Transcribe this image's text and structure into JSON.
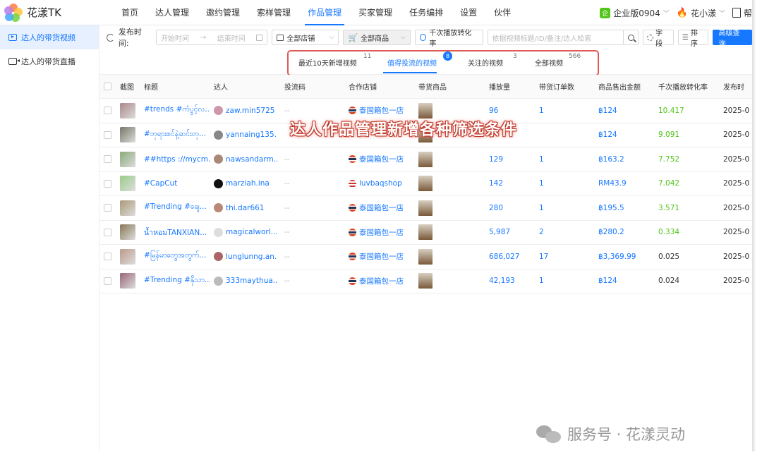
{
  "app": {
    "logo_text": "花漾TK",
    "nav": [
      "首页",
      "达人管理",
      "邀约管理",
      "索样管理",
      "作品管理",
      "买家管理",
      "任务编排",
      "设置",
      "伙伴"
    ],
    "active_nav": "作品管理",
    "enterprise_icon_text": "企",
    "enterprise": "企业版0904",
    "user": "花小漾",
    "right_cut": "帮"
  },
  "sidebar": {
    "items": [
      {
        "label": "达人的带货视频",
        "active": true,
        "icon": "video-icon"
      },
      {
        "label": "达人的带货直播",
        "active": false,
        "icon": "live-icon"
      }
    ]
  },
  "filters": {
    "publish_time_label": "发布时间:",
    "start_placeholder": "开始时间",
    "end_placeholder": "结束时间",
    "date_arrow": "→",
    "shop_select": "全部店铺",
    "product_select": "全部商品",
    "conversion_button": "千次播放转化率",
    "search_placeholder": "依据视频标题/ID/备注/达人检索",
    "fields_button": "字段",
    "sort_button": "排序",
    "advanced_button": "高级查询"
  },
  "tabs": [
    {
      "label": "最近10天新增视频",
      "count": "11",
      "active": false
    },
    {
      "label": "值得投流的视频",
      "count": "8",
      "active": true
    },
    {
      "label": "关注的视频",
      "count": "3",
      "active": false
    },
    {
      "label": "全部视频",
      "count": "566",
      "active": false
    }
  ],
  "table": {
    "columns": [
      "截图",
      "标题",
      "达人",
      "投流码",
      "合作店铺",
      "带货商品",
      "播放量",
      "带货订单数",
      "商品售出金额",
      "千次播放转化率",
      "发布时"
    ],
    "rows": [
      {
        "title": "#trends #ကံပွင့်လ...",
        "creator": "zaw.min5725",
        "code": "--",
        "shop": "泰国箱包一店",
        "shop_flag": "th",
        "plays": "96",
        "orders": "1",
        "amount": "฿124",
        "conv": "10.417",
        "conv_green": true,
        "date": "2025-0"
      },
      {
        "title": "#ဘုရားစင်နဲ့ဆင်းတု...",
        "creator": "yannaing135...",
        "code": "",
        "shop": "",
        "shop_flag": "",
        "plays": "",
        "orders": "",
        "amount": "฿124",
        "conv": "9.091",
        "conv_green": true,
        "date": "2025-0"
      },
      {
        "title": "##https ://mycm...",
        "creator": "nawsandarm...",
        "code": "--",
        "shop": "泰国箱包一店",
        "shop_flag": "th",
        "plays": "129",
        "orders": "1",
        "amount": "฿163.2",
        "conv": "7.752",
        "conv_green": true,
        "date": "2025-0"
      },
      {
        "title": "#CapCut",
        "creator": "marziah.ina",
        "code": "--",
        "shop": "luvbaqshop",
        "shop_flag": "us",
        "plays": "142",
        "orders": "1",
        "amount": "RM43.9",
        "conv": "7.042",
        "conv_green": true,
        "date": "2025-0"
      },
      {
        "title": "#Trending #ချေ...",
        "creator": "thi.dar661",
        "code": "--",
        "shop": "泰国箱包一店",
        "shop_flag": "th",
        "plays": "280",
        "orders": "1",
        "amount": "฿195.5",
        "conv": "3.571",
        "conv_green": true,
        "date": "2025-0"
      },
      {
        "title": "น้ำหอมTANXIAN...",
        "creator": "magicalworl...",
        "code": "--",
        "shop": "泰国箱包一店",
        "shop_flag": "th",
        "plays": "5,987",
        "orders": "2",
        "amount": "฿280.2",
        "conv": "0.334",
        "conv_green": true,
        "date": "2025-0"
      },
      {
        "title": "#မြန်မာတွေအတွက်...",
        "creator": "lunglunng.an...",
        "code": "--",
        "shop": "泰国箱包一店",
        "shop_flag": "th",
        "plays": "686,027",
        "orders": "17",
        "amount": "฿3,369.99",
        "conv": "0.025",
        "conv_green": false,
        "date": "2025-0"
      },
      {
        "title": "#Trending #နိုသာ...",
        "creator": "333maythua...",
        "code": "--",
        "shop": "泰国箱包一店",
        "shop_flag": "th",
        "plays": "42,193",
        "orders": "1",
        "amount": "฿124",
        "conv": "0.024",
        "conv_green": false,
        "date": "2025-0"
      }
    ]
  },
  "overlay_caption": "达人作品管理新增各种筛选条件",
  "watermark": "服务号 · 花漾灵动",
  "colors": {
    "accent": "#1677ff",
    "green": "#52c41a",
    "highlight_red": "#e05a5a"
  }
}
